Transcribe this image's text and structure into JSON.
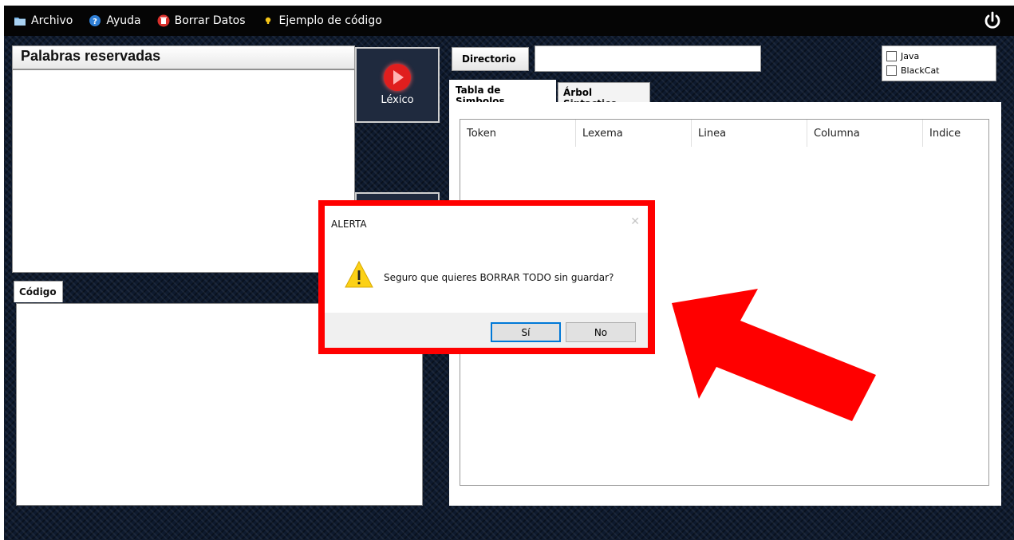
{
  "menu": {
    "items": [
      {
        "label": "Archivo",
        "icon": "folder-icon"
      },
      {
        "label": "Ayuda",
        "icon": "help-icon"
      },
      {
        "label": "Borrar Datos",
        "icon": "trash-icon"
      },
      {
        "label": "Ejemplo de código",
        "icon": "lightbulb-icon"
      }
    ],
    "power_icon": "power-icon"
  },
  "reserved": {
    "title": "Palabras reservadas"
  },
  "lexico": {
    "label": "Léxico"
  },
  "code": {
    "tab_label": "Código"
  },
  "directory": {
    "button_label": "Directorio",
    "value": ""
  },
  "languages": [
    {
      "label": "Java",
      "checked": false
    },
    {
      "label": "BlackCat",
      "checked": false
    }
  ],
  "tabs": [
    {
      "label": "Tabla de Simbolos",
      "active": true
    },
    {
      "label": "Árbol Sintactico",
      "active": false
    }
  ],
  "symbol_table": {
    "columns": [
      "Token",
      "Lexema",
      "Linea",
      "Columna",
      "Indice"
    ]
  },
  "dialog": {
    "title": "ALERTA",
    "message": "Seguro que quieres BORRAR TODO sin guardar?",
    "yes_label": "Sí",
    "no_label": "No",
    "close_glyph": "✕"
  },
  "colors": {
    "highlight": "#ff0000",
    "menubar": "#050505",
    "accent_button": "#e01e1e"
  }
}
